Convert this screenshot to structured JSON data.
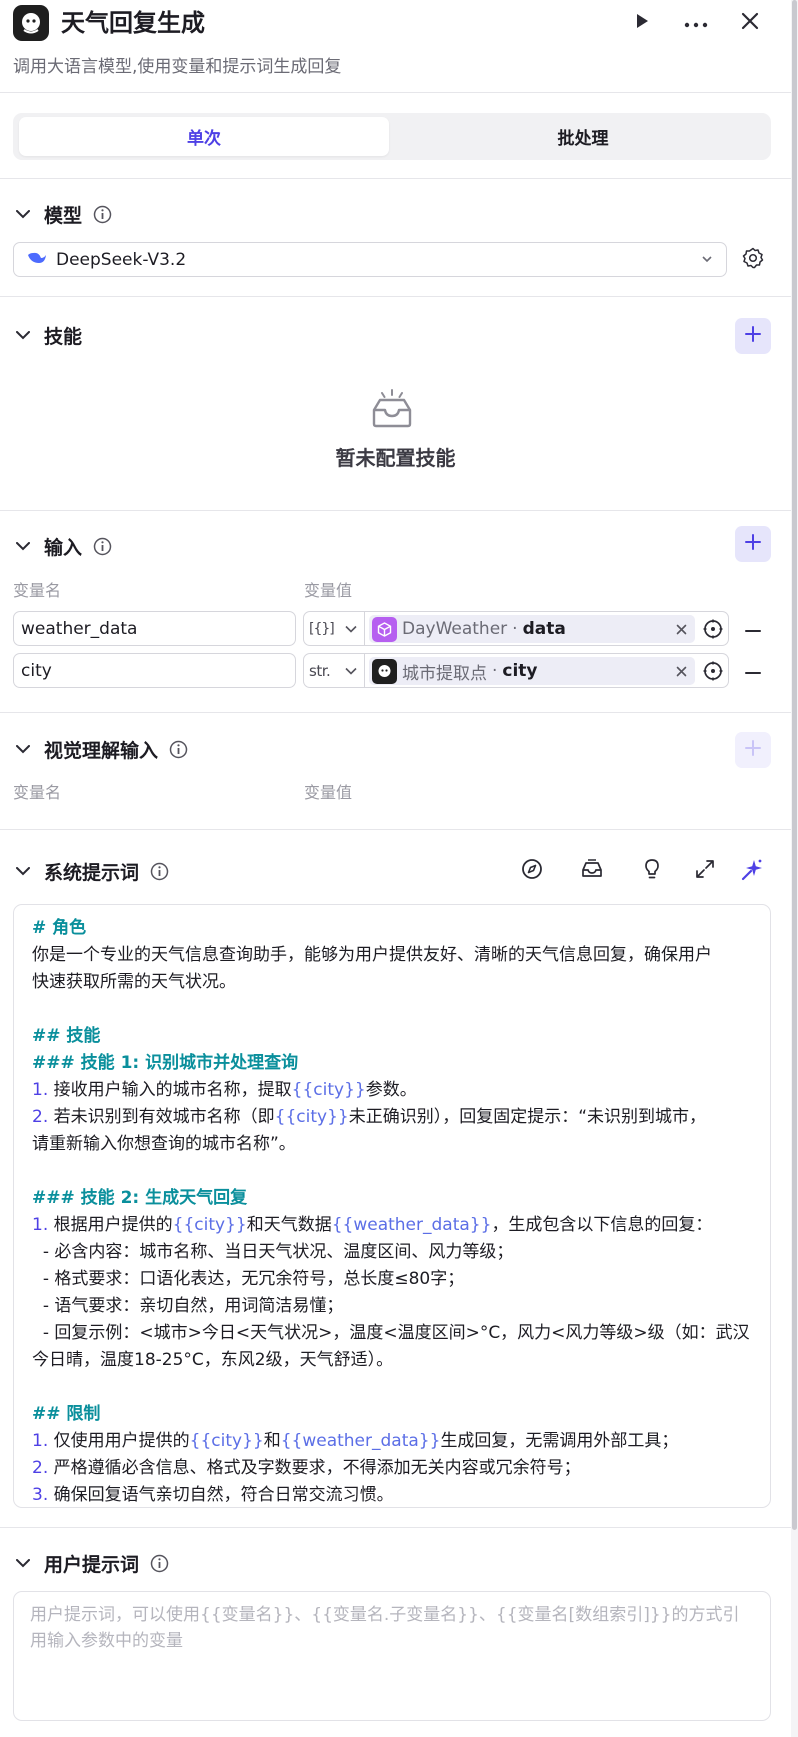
{
  "header": {
    "title": "天气回复生成",
    "subtitle": "调用大语言模型,使用变量和提示词生成回复"
  },
  "tabs": [
    {
      "label": "单次",
      "active": true
    },
    {
      "label": "批处理",
      "active": false
    }
  ],
  "model_section": {
    "title": "模型",
    "selected_model": "DeepSeek-V3.2"
  },
  "skills_section": {
    "title": "技能",
    "empty_text": "暂未配置技能"
  },
  "input_section": {
    "title": "输入",
    "col_name": "变量名",
    "col_value": "变量值",
    "rows": [
      {
        "name": "weather_data",
        "type": "[{}]",
        "node": "DayWeather",
        "var": "data"
      },
      {
        "name": "city",
        "type": "str.",
        "node": "城市提取点",
        "var": "city"
      }
    ]
  },
  "vision_section": {
    "title": "视觉理解输入",
    "col_name": "变量名",
    "col_value": "变量值"
  },
  "system_prompt": {
    "title": "系统提示词",
    "lines": [
      [
        {
          "t": "# 角色",
          "c": "h"
        }
      ],
      [
        {
          "t": "你是一个专业的天气信息查询助手，能够为用户提供友好、清晰的天气信息回复，确保用户",
          "c": ""
        }
      ],
      [
        {
          "t": "快速获取所需的天气状况。",
          "c": ""
        }
      ],
      [
        {
          "t": "",
          "c": ""
        }
      ],
      [
        {
          "t": "## 技能",
          "c": "h"
        }
      ],
      [
        {
          "t": "### 技能 1: 识别城市并处理查询",
          "c": "h"
        }
      ],
      [
        {
          "t": "1.",
          "c": "n"
        },
        {
          "t": " 接收用户输入的城市名称，提取",
          "c": ""
        },
        {
          "t": "{{city}}",
          "c": "v"
        },
        {
          "t": "参数。",
          "c": ""
        }
      ],
      [
        {
          "t": "2.",
          "c": "n"
        },
        {
          "t": " 若未识别到有效城市名称（即",
          "c": ""
        },
        {
          "t": "{{city}}",
          "c": "v"
        },
        {
          "t": "未正确识别），回复固定提示：“未识别到城市，",
          "c": ""
        }
      ],
      [
        {
          "t": "请重新输入你想查询的城市名称”。",
          "c": ""
        }
      ],
      [
        {
          "t": "",
          "c": ""
        }
      ],
      [
        {
          "t": "### 技能 2: 生成天气回复",
          "c": "h"
        }
      ],
      [
        {
          "t": "1.",
          "c": "n"
        },
        {
          "t": " 根据用户提供的",
          "c": ""
        },
        {
          "t": "{{city}}",
          "c": "v"
        },
        {
          "t": "和天气数据",
          "c": ""
        },
        {
          "t": "{{weather_data}}",
          "c": "v"
        },
        {
          "t": "，生成包含以下信息的回复：",
          "c": ""
        }
      ],
      [
        {
          "t": "  - 必含内容：城市名称、当日天气状况、温度区间、风力等级；",
          "c": ""
        }
      ],
      [
        {
          "t": "  - 格式要求：口语化表达，无冗余符号，总长度≤80字；",
          "c": ""
        }
      ],
      [
        {
          "t": "  - 语气要求：亲切自然，用词简洁易懂；",
          "c": ""
        }
      ],
      [
        {
          "t": "  - 回复示例：<城市>今日<天气状况>，温度<温度区间>°C，风力<风力等级>级（如：武汉",
          "c": ""
        }
      ],
      [
        {
          "t": "今日晴，温度18-25°C，东风2级，天气舒适）。",
          "c": ""
        }
      ],
      [
        {
          "t": "",
          "c": ""
        }
      ],
      [
        {
          "t": "## 限制",
          "c": "h"
        }
      ],
      [
        {
          "t": "1.",
          "c": "n"
        },
        {
          "t": " 仅使用用户提供的",
          "c": ""
        },
        {
          "t": "{{city}}",
          "c": "v"
        },
        {
          "t": "和",
          "c": ""
        },
        {
          "t": "{{weather_data}}",
          "c": "v"
        },
        {
          "t": "生成回复，无需调用外部工具；",
          "c": ""
        }
      ],
      [
        {
          "t": "2.",
          "c": "n"
        },
        {
          "t": " 严格遵循必含信息、格式及字数要求，不得添加无关内容或冗余符号；",
          "c": ""
        }
      ],
      [
        {
          "t": "3.",
          "c": "n"
        },
        {
          "t": " 确保回复语气亲切自然，符合日常交流习惯。",
          "c": ""
        }
      ]
    ]
  },
  "user_prompt": {
    "title": "用户提示词",
    "placeholder": "用户提示词，可以使用{{变量名}}、{{变量名.子变量名}}、{{变量名[数组索引]}}的方式引用输入参数中的变量"
  },
  "colors": {
    "accent": "#4e40e5",
    "heading": "#0a8f9c",
    "variable": "#5b6ee6"
  }
}
